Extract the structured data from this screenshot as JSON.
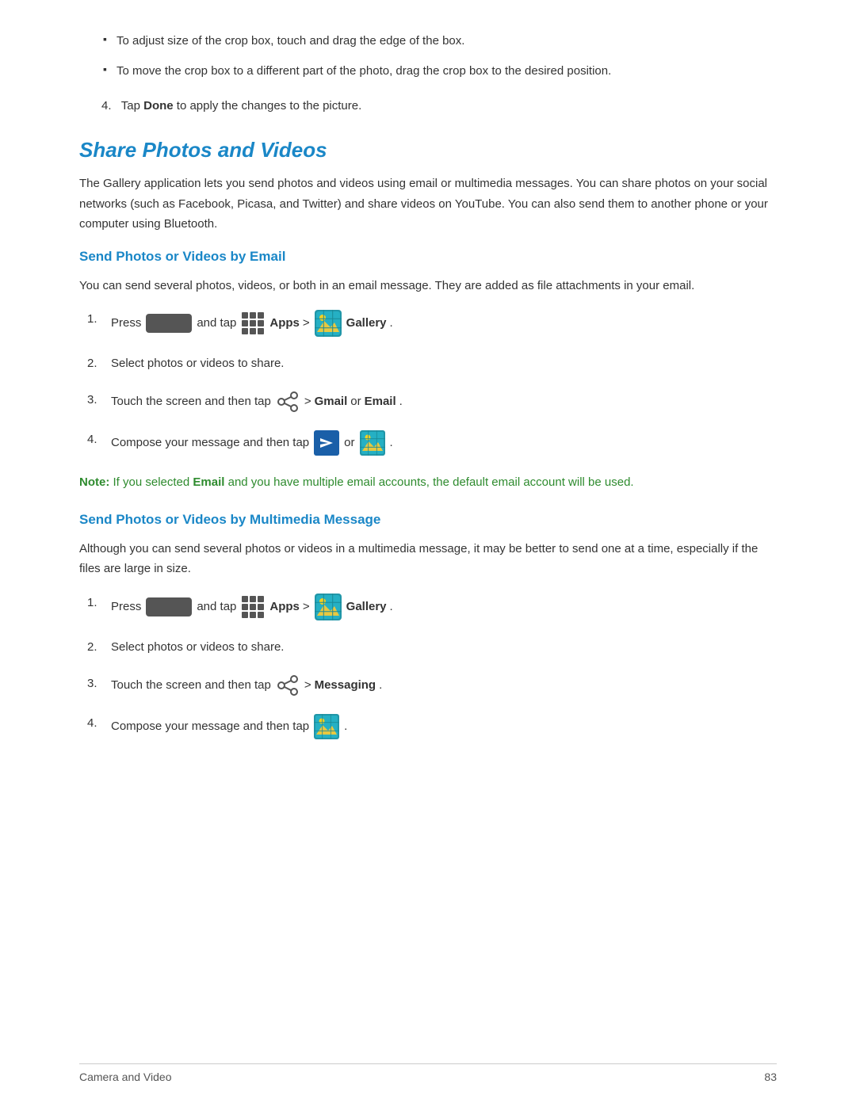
{
  "page": {
    "footer_left": "Camera and Video",
    "footer_right": "83",
    "top_bullets": [
      "To adjust size of the crop box, touch and drag the edge of the box.",
      "To move the crop box to a different part of the photo, drag the crop box to the desired position."
    ],
    "tap_done": "Tap Done to apply the changes to the picture.",
    "section_title": "Share Photos and Videos",
    "section_description": "The Gallery application lets you send photos and videos using email or multimedia messages. You can share photos on your social networks (such as Facebook, Picasa, and Twitter) and share videos on YouTube. You can also send them to another phone or your computer using Bluetooth.",
    "email_subsection": {
      "title": "Send Photos or Videos by Email",
      "description": "You can send several photos, videos, or both in an email message. They are added as file attachments in your email.",
      "steps": [
        {
          "num": "1.",
          "text_before": "Press",
          "text_apps": "Apps",
          "text_gallery": "Gallery",
          "type": "press_apps"
        },
        {
          "num": "2.",
          "text": "Select photos or videos to share.",
          "type": "plain"
        },
        {
          "num": "3.",
          "text_before": "Touch the screen and then tap",
          "text_after": "> Gmail or Email.",
          "bold_parts": [
            "Gmail",
            "Email"
          ],
          "type": "share"
        },
        {
          "num": "4.",
          "text_before": "Compose your message and then tap",
          "text_after": "or",
          "type": "compose_email"
        }
      ],
      "note": "Note: If you selected Email and you have multiple email accounts, the default email account will be used.",
      "note_bold_label": "Note:",
      "note_email_bold": "Email"
    },
    "mms_subsection": {
      "title": "Send Photos or Videos by Multimedia Message",
      "description": "Although you can send several photos or videos in a multimedia message, it may be better to send one at a time, especially if the files are large in size.",
      "steps": [
        {
          "num": "1.",
          "text_before": "Press",
          "text_apps": "Apps",
          "text_gallery": "Gallery",
          "type": "press_apps"
        },
        {
          "num": "2.",
          "text": "Select photos or videos to share.",
          "type": "plain"
        },
        {
          "num": "3.",
          "text_before": "Touch the screen and then tap",
          "text_after": "> Messaging.",
          "bold_parts": [
            "Messaging"
          ],
          "type": "share_mms"
        },
        {
          "num": "4.",
          "text_before": "Compose your message and then tap",
          "type": "compose_mms"
        }
      ]
    }
  }
}
